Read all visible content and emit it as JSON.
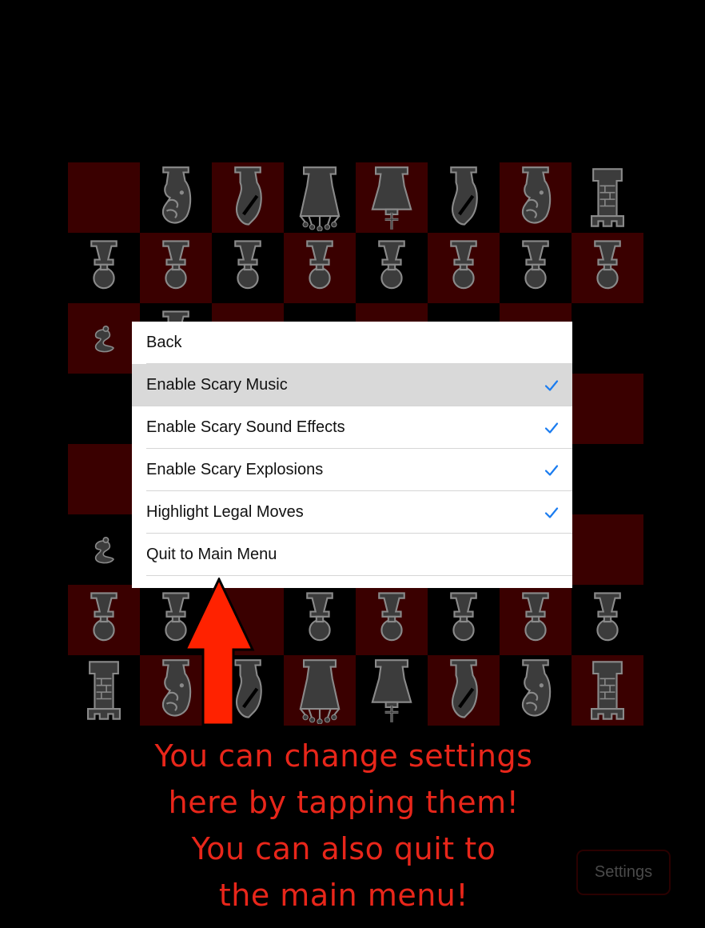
{
  "board": {
    "rows": [
      [
        "empty",
        "knight",
        "bishop",
        "queen",
        "king",
        "bishop",
        "knight",
        "rook"
      ],
      [
        "pawn",
        "pawn",
        "pawn",
        "pawn",
        "pawn",
        "pawn",
        "pawn",
        "pawn"
      ],
      [
        "pawn-fallen",
        "pawn-top",
        "empty",
        "empty",
        "empty",
        "empty",
        "empty",
        "empty"
      ],
      [
        "empty",
        "empty",
        "empty",
        "empty",
        "empty",
        "empty",
        "empty",
        "empty"
      ],
      [
        "empty",
        "empty",
        "empty",
        "empty",
        "empty",
        "empty",
        "empty",
        "empty"
      ],
      [
        "pawn-fallen",
        "empty",
        "empty",
        "empty",
        "empty",
        "empty",
        "empty",
        "empty"
      ],
      [
        "pawn",
        "pawn",
        "empty",
        "pawn",
        "pawn",
        "pawn",
        "pawn",
        "pawn"
      ],
      [
        "rook",
        "knight",
        "bishop",
        "queen",
        "king",
        "bishop",
        "knight",
        "rook"
      ]
    ]
  },
  "menu": {
    "items": [
      {
        "label": "Back",
        "checked": false,
        "selected": false
      },
      {
        "label": "Enable Scary Music",
        "checked": true,
        "selected": true
      },
      {
        "label": "Enable Scary Sound Effects",
        "checked": true,
        "selected": false
      },
      {
        "label": "Enable Scary Explosions",
        "checked": true,
        "selected": false
      },
      {
        "label": "Highlight Legal Moves",
        "checked": true,
        "selected": false
      },
      {
        "label": "Quit to Main Menu",
        "checked": false,
        "selected": false
      }
    ]
  },
  "tutorial": {
    "lines": [
      "You can change settings",
      "here by tapping them!",
      "You can also quit to",
      "the main menu!"
    ]
  },
  "settings_button": {
    "label": "Settings"
  },
  "colors": {
    "dark_square": "#3a0000",
    "light_square": "#000000",
    "piece": "#3c3c3c",
    "piece_outline": "#8a8a8a",
    "check": "#1a7cf0",
    "arrow": "#ff2200",
    "tutorial_text": "#e8261a"
  }
}
